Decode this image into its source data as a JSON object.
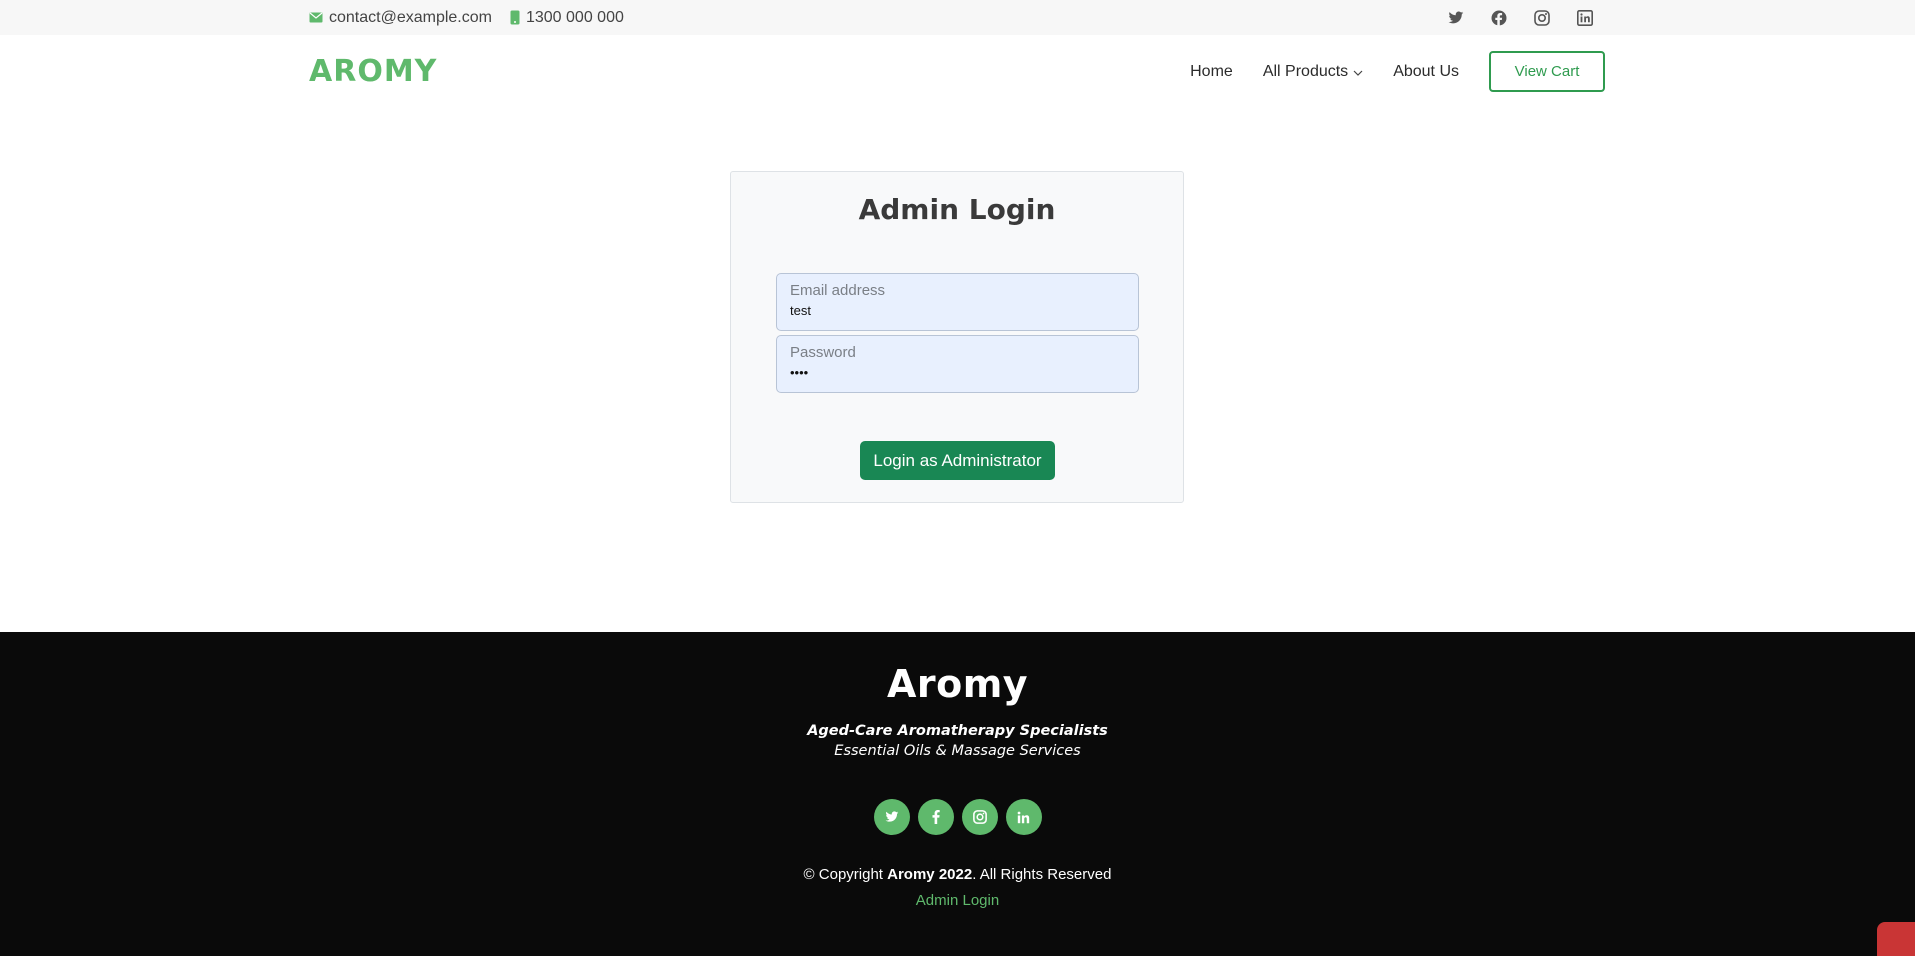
{
  "topbar": {
    "email": "contact@example.com",
    "phone": "1300 000 000",
    "social_icons": [
      "twitter-icon",
      "facebook-icon",
      "instagram-icon",
      "linkedin-icon"
    ]
  },
  "nav": {
    "logo": "AROMY",
    "links": [
      "Home",
      "All Products",
      "About Us"
    ],
    "cart": "View Cart"
  },
  "login": {
    "title": "Admin Login",
    "email_label": "Email address",
    "email_value": "test",
    "password_label": "Password",
    "password_value": "••••",
    "button": "Login as Administrator"
  },
  "footer": {
    "title": "Aromy",
    "tagline": "Aged-Care Aromatherapy Specialists",
    "subtagline": "Essential Oils & Massage Services",
    "copyright_prefix": "© Copyright ",
    "copyright_brand": "Aromy 2022",
    "copyright_suffix": ". All Rights Reserved",
    "admin_link": "Admin Login"
  },
  "colors": {
    "accent": "#5fb96c",
    "button_green": "#198754",
    "footer_bg": "#0a0a0a"
  }
}
